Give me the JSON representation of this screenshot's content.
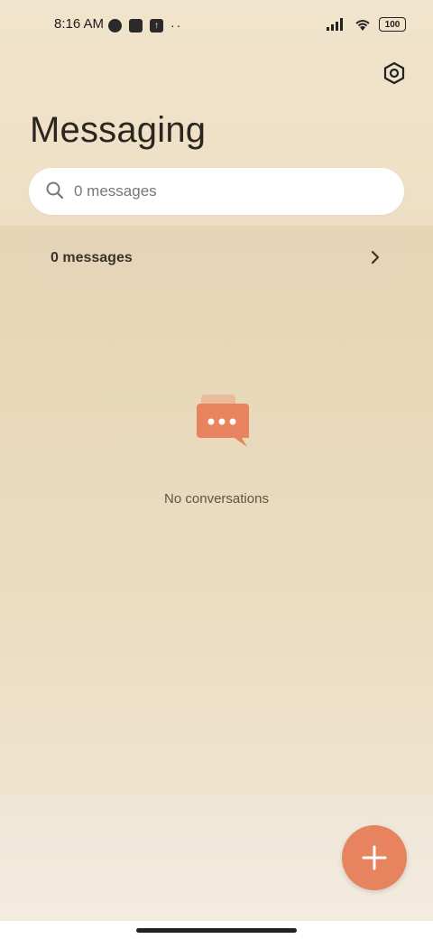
{
  "status_bar": {
    "time": "8:16 AM",
    "battery": "100",
    "icons": [
      "circle-icon",
      "square-icon",
      "upload-icon",
      "more-dots-icon",
      "signal-icon",
      "wifi-icon",
      "battery-icon"
    ]
  },
  "header": {
    "title": "Messaging",
    "settings_icon": "settings-hex-icon"
  },
  "search": {
    "placeholder": "0 messages",
    "icon": "search-icon"
  },
  "summary_row": {
    "label": "0 messages",
    "icon": "chevron-right-icon"
  },
  "empty_state": {
    "text": "No conversations",
    "icon": "chat-bubbles-icon"
  },
  "fab": {
    "icon": "plus-icon"
  },
  "colors": {
    "accent": "#e7835f",
    "background": "#efe3cd",
    "search_bg": "#ffffff"
  }
}
